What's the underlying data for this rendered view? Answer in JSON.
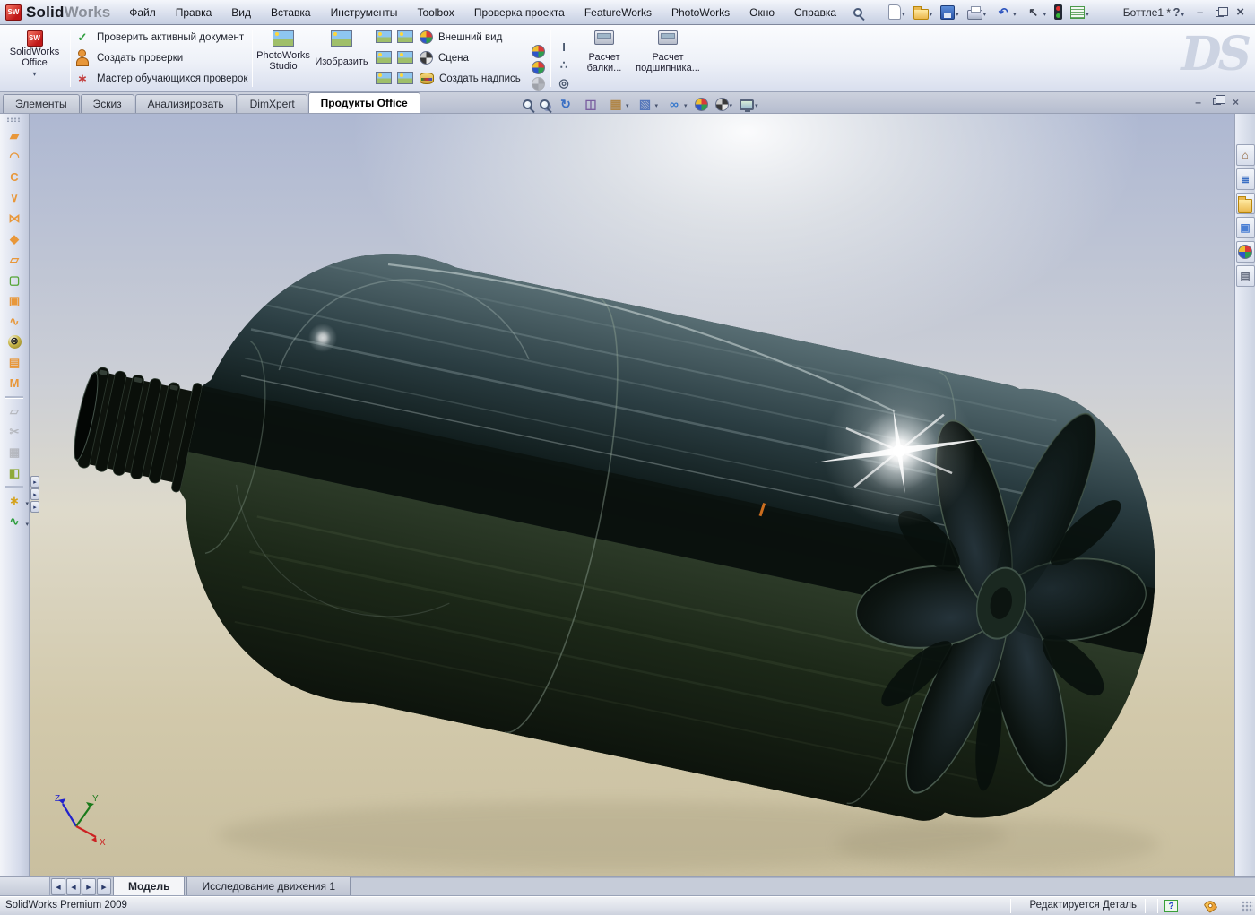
{
  "window": {
    "app_solid": "Solid",
    "app_works": "Works",
    "cube_text": "SW",
    "title": "Боттле1 *",
    "help": "?",
    "minimize": "–",
    "close": "×"
  },
  "menubar": {
    "items": [
      {
        "name": "menu-file",
        "label": "Файл"
      },
      {
        "name": "menu-edit",
        "label": "Правка"
      },
      {
        "name": "menu-view",
        "label": "Вид"
      },
      {
        "name": "menu-insert",
        "label": "Вставка"
      },
      {
        "name": "menu-tools",
        "label": "Инструменты"
      },
      {
        "name": "menu-toolbox",
        "label": "Toolbox"
      },
      {
        "name": "menu-design-checker",
        "label": "Проверка проекта"
      },
      {
        "name": "menu-featureworks",
        "label": "FeatureWorks"
      },
      {
        "name": "menu-photoworks",
        "label": "PhotoWorks"
      },
      {
        "name": "menu-window",
        "label": "Окно"
      },
      {
        "name": "menu-help",
        "label": "Справка"
      }
    ]
  },
  "quickbar": {
    "icons": [
      {
        "name": "new-document-icon",
        "cls": "i-page",
        "dropdown": true
      },
      {
        "name": "open-document-icon",
        "cls": "i-folder",
        "dropdown": true
      },
      {
        "name": "save-icon",
        "cls": "i-floppy",
        "dropdown": true
      },
      {
        "name": "print-icon",
        "cls": "i-printer",
        "dropdown": true
      },
      {
        "name": "undo-icon",
        "glyph": "↶",
        "fg": "#2a52be",
        "dropdown": true
      },
      {
        "name": "select-icon",
        "glyph": "↖",
        "fg": "#3a3f4c",
        "dropdown": true
      },
      {
        "name": "design-check-lights-icon",
        "cls": "i-traffic"
      },
      {
        "name": "options-icon",
        "cls": "i-checklist",
        "dropdown": true
      }
    ]
  },
  "ribbon": {
    "office": {
      "line1": "SolidWorks",
      "line2": "Office"
    },
    "checker_items": [
      {
        "name": "check-active-document",
        "glyph": "✓",
        "fg": "#2e9e3e",
        "label": "Проверить активный документ"
      },
      {
        "name": "build-checks",
        "cls": "i-person",
        "label": "Создать проверки"
      },
      {
        "name": "learned-checks-wizard",
        "glyph": "∗",
        "fg": "#c23b3b",
        "label": "Мастер обучающихся проверок"
      }
    ],
    "studio": {
      "line1": "PhotoWorks",
      "line2": "Studio"
    },
    "render_label": "Изобразить",
    "grid_icons": [
      {
        "name": "render-to-file-icon",
        "cls": "i-image"
      },
      {
        "name": "render-selection-icon",
        "cls": "i-image"
      },
      {
        "name": "render-region-icon",
        "cls": "i-image"
      },
      {
        "name": "preview-window-icon",
        "cls": "i-image"
      },
      {
        "name": "render-last-icon",
        "cls": "i-image"
      },
      {
        "name": "edit-render-icon",
        "cls": "i-image"
      }
    ],
    "appearance_items": [
      {
        "name": "appearance-sphere-icon",
        "cls": "i-sphere",
        "label": "Внешний вид"
      },
      {
        "name": "scene-icon",
        "cls": "i-scene",
        "label": "Сцена"
      },
      {
        "name": "decal-icon",
        "cls": "i-can",
        "label": "Создать надпись"
      }
    ],
    "copy_icons": [
      {
        "name": "copy-appearance-icon",
        "cls": "i-sphere"
      },
      {
        "name": "paste-appearance-icon",
        "cls": "i-sphere"
      },
      {
        "name": "paste-appearance-disabled-icon",
        "cls": "i-sphere",
        "disabled": true
      }
    ],
    "calc_icons": [
      {
        "name": "beam-section-icon",
        "glyph": "I",
        "fg": "#4c5a70"
      },
      {
        "name": "bolt-pattern-icon",
        "glyph": "∴",
        "fg": "#4c5a70"
      },
      {
        "name": "bearing-ring-icon",
        "glyph": "◎",
        "fg": "#4c5a70"
      }
    ],
    "beam_button": {
      "line1": "Расчет",
      "line2": "балки..."
    },
    "bearing_button": {
      "line1": "Расчет",
      "line2": "подшипника..."
    },
    "watermark": "DS"
  },
  "command_tabs": {
    "tabs": [
      {
        "name": "tab-features",
        "label": "Элементы"
      },
      {
        "name": "tab-sketch",
        "label": "Эскиз"
      },
      {
        "name": "tab-evaluate",
        "label": "Анализировать"
      },
      {
        "name": "tab-dimxpert",
        "label": "DimXpert"
      },
      {
        "name": "tab-office-products",
        "label": "Продукты Office",
        "active": true
      }
    ]
  },
  "hud": {
    "icons": [
      {
        "name": "zoom-fit-icon",
        "cls": "i-mag"
      },
      {
        "name": "zoom-area-icon",
        "cls": "i-mag i-mag2"
      },
      {
        "name": "rotate-view-icon",
        "glyph": "↻",
        "fg": "#3a6fc4"
      },
      {
        "name": "section-view-icon",
        "glyph": "◫",
        "fg": "#7a5fa0"
      },
      {
        "name": "view-orientation-icon",
        "glyph": "▦",
        "fg": "#b08648",
        "dropdown": true
      },
      {
        "name": "display-style-icon",
        "glyph": "▧",
        "fg": "#5577bb",
        "dropdown": true
      },
      {
        "name": "hide-show-items-icon",
        "glyph": "∞",
        "fg": "#3377cc",
        "dropdown": true
      },
      {
        "name": "edit-appearance-icon",
        "cls": "i-sphere"
      },
      {
        "name": "apply-scene-icon",
        "cls": "i-scene",
        "dropdown": true
      },
      {
        "name": "view-settings-icon",
        "cls": "i-monitor",
        "dropdown": true
      }
    ]
  },
  "doc_controls": {
    "minimize": "–",
    "close": "×"
  },
  "left_toolbar": {
    "icons": [
      {
        "name": "extruded-surface-icon",
        "glyph": "▰",
        "fg": "#e8973a"
      },
      {
        "name": "revolved-surface-icon",
        "glyph": "◠",
        "fg": "#e8973a"
      },
      {
        "name": "swept-surface-icon",
        "glyph": "C",
        "fg": "#e8973a"
      },
      {
        "name": "lofted-surface-icon",
        "glyph": "∨",
        "fg": "#e8973a"
      },
      {
        "name": "boundary-surface-icon",
        "glyph": "⋈",
        "fg": "#e8973a"
      },
      {
        "name": "filled-surface-icon",
        "glyph": "◆",
        "fg": "#e8973a"
      },
      {
        "name": "planar-surface-icon",
        "glyph": "▱",
        "fg": "#e8973a"
      },
      {
        "name": "offset-surface-icon",
        "glyph": "▢",
        "fg": "#57a639"
      },
      {
        "name": "ruled-surface-icon",
        "glyph": "▣",
        "fg": "#e8973a"
      },
      {
        "name": "freeform-surface-icon",
        "glyph": "∿",
        "fg": "#e8973a"
      },
      {
        "name": "delete-face-icon",
        "glyph": "⊗",
        "cls": "i-ball"
      },
      {
        "name": "replace-face-icon",
        "glyph": "▤",
        "fg": "#e8973a"
      },
      {
        "name": "untrim-surface-icon",
        "glyph": "M",
        "fg": "#e8973a"
      },
      {
        "sep": true
      },
      {
        "name": "extend-surface-icon",
        "glyph": "▱",
        "fg": "#888",
        "disabled": true
      },
      {
        "name": "trim-surface-icon",
        "glyph": "✂",
        "fg": "#888",
        "disabled": true
      },
      {
        "name": "knit-surface-icon",
        "glyph": "▦",
        "fg": "#888",
        "disabled": true
      },
      {
        "name": "intersection-icon",
        "glyph": "◧",
        "fg": "#8faa3a"
      },
      {
        "sep": true
      },
      {
        "name": "reference-geometry-icon",
        "glyph": "∗",
        "fg": "#d4a017",
        "dropdown": true
      },
      {
        "name": "curves-spline-icon",
        "glyph": "∿",
        "fg": "#2e9e3e",
        "dropdown": true
      }
    ]
  },
  "right_panel": {
    "icons": [
      {
        "name": "resources-tab-icon",
        "glyph": "⌂",
        "fg": "#8a5a2a"
      },
      {
        "name": "design-library-tab-icon",
        "glyph": "≣",
        "fg": "#3a6fc4"
      },
      {
        "name": "file-explorer-tab-icon",
        "cls": "i-folder"
      },
      {
        "name": "view-palette-tab-icon",
        "glyph": "▣",
        "fg": "#4a7fd4"
      },
      {
        "name": "appearances-tab-icon",
        "cls": "i-sphere"
      },
      {
        "name": "custom-properties-tab-icon",
        "glyph": "▤",
        "fg": "#666e80"
      }
    ]
  },
  "viewport": {
    "triad": {
      "z": "Z",
      "y": "Y",
      "x": "X"
    }
  },
  "bottom_bar": {
    "nav": [
      {
        "name": "first-tab-button",
        "glyph": "◀"
      },
      {
        "name": "prev-tab-button",
        "glyph": "◀"
      },
      {
        "name": "next-tab-button",
        "glyph": "▶"
      },
      {
        "name": "last-tab-button",
        "glyph": "▶"
      }
    ],
    "tabs": [
      {
        "name": "model-tab",
        "label": "Модель",
        "active": true
      },
      {
        "name": "motion-study-tab",
        "label": "Исследование движения 1"
      }
    ]
  },
  "statusbar": {
    "left": "SolidWorks Premium 2009",
    "edit_state": "Редактируется Деталь",
    "help": "?"
  }
}
